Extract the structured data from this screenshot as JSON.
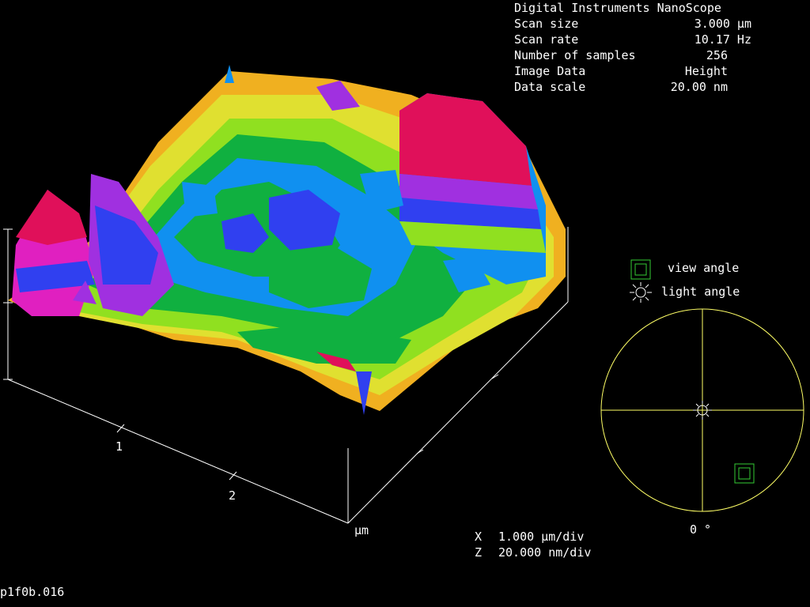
{
  "info": {
    "header": "Digital Instruments NanoScope",
    "rows": [
      {
        "label": "Scan size",
        "value": "3.000 µm"
      },
      {
        "label": "Scan rate",
        "value": "10.17 Hz"
      },
      {
        "label": "Number of samples",
        "value": "256"
      },
      {
        "label": "Image Data",
        "value": "Height"
      },
      {
        "label": "Data scale",
        "value": "20.00 nm"
      }
    ]
  },
  "axes": {
    "tick_labels": [
      "1",
      "2"
    ],
    "unit": "µm"
  },
  "scale": {
    "x_prefix": "X",
    "x_value": "1.000 µm/div",
    "z_prefix": "Z",
    "z_value": "20.000 nm/div"
  },
  "angle_panel": {
    "view_label": "view angle",
    "light_label": "light angle",
    "angle_readout": "0 °"
  },
  "filename": "p1f0b.016",
  "colors": {
    "axis": "#ffffff",
    "angle_circle": "#ffff66",
    "view_icon": "#33cc33",
    "bands": [
      "#e0105a",
      "#e020c0",
      "#a030e0",
      "#3040f0",
      "#1090f0",
      "#10b040",
      "#90e020",
      "#e0e030",
      "#f0b020",
      "#f07010"
    ]
  }
}
